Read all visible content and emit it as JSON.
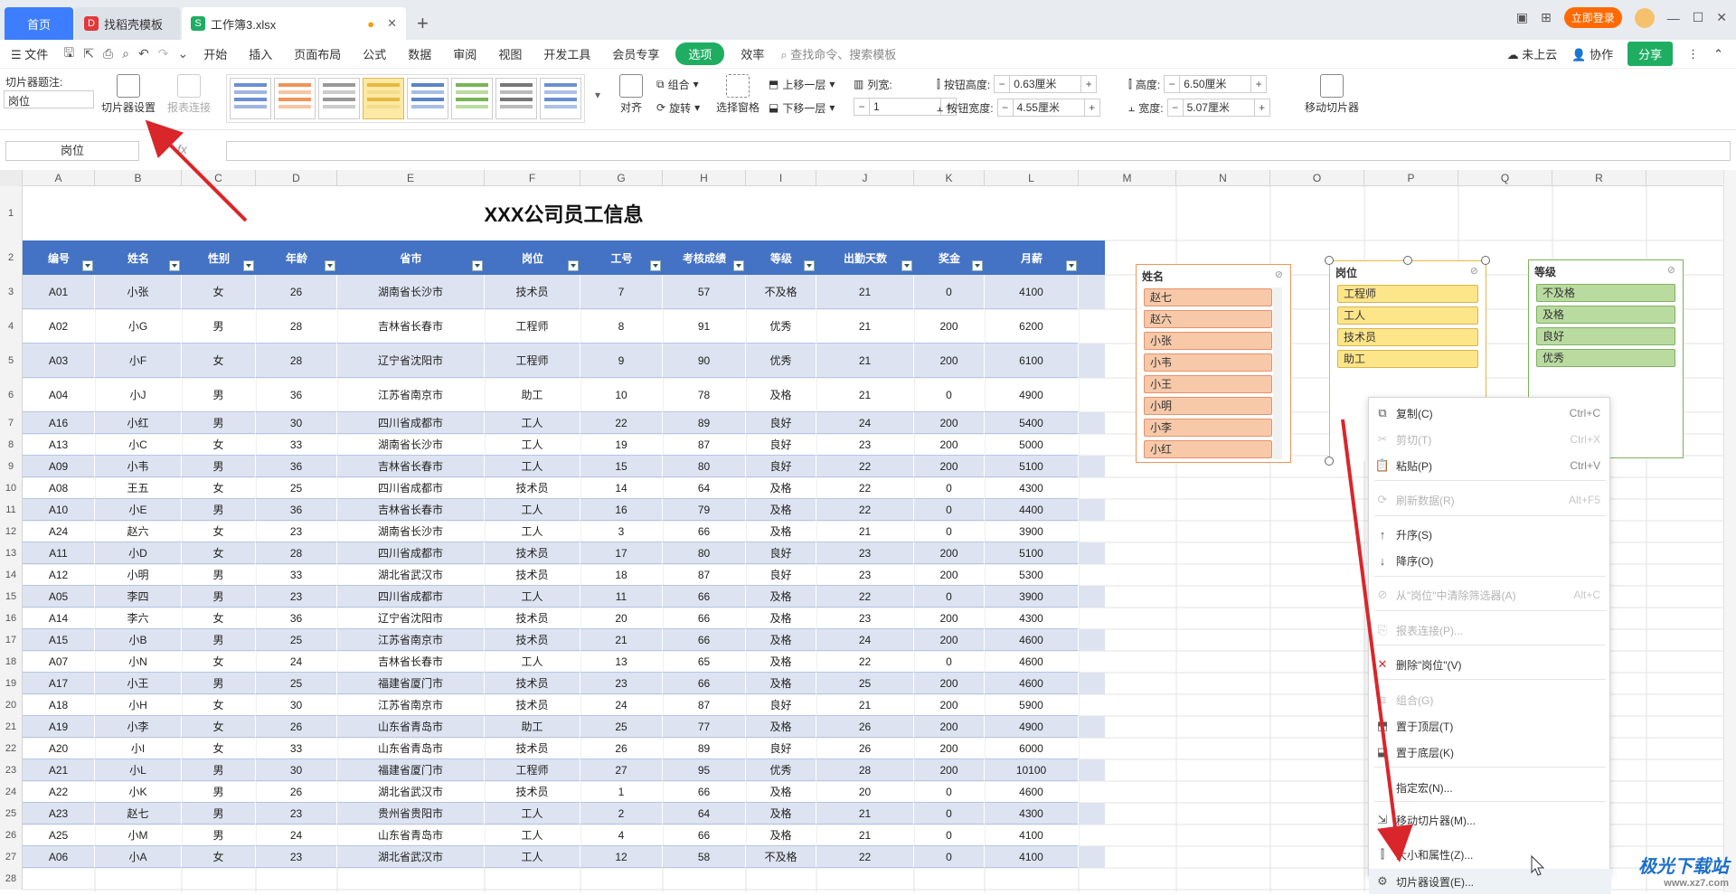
{
  "tabs": {
    "home": "首页",
    "templates": "找稻壳模板",
    "file": "工作簿3.xlsx",
    "plus": "+"
  },
  "window": {
    "login": "立即登录"
  },
  "menu": {
    "file": "文件",
    "items": [
      "开始",
      "插入",
      "页面布局",
      "公式",
      "数据",
      "审阅",
      "视图",
      "开发工具",
      "会员专享"
    ],
    "active": "选项",
    "efficiency": "效率",
    "search": "查找命令、搜索模板",
    "not_cloud": "未上云",
    "collab": "协作",
    "share": "分享"
  },
  "ribbon": {
    "caption_label": "切片器题注:",
    "caption_value": "岗位",
    "slicer_settings": "切片器设置",
    "report_link": "报表连接",
    "align": "对齐",
    "group": "组合",
    "rotate": "旋转",
    "selection_pane": "选择窗格",
    "bring_forward": "上移一层",
    "send_backward": "下移一层",
    "columns_label": "列宽:",
    "columns_value": "1",
    "btn_height_label": "按钮高度:",
    "btn_height": "0.63厘米",
    "btn_width_label": "按钮宽度:",
    "btn_width": "4.55厘米",
    "height_label": "高度:",
    "height": "6.50厘米",
    "width_label": "宽度:",
    "width": "5.07厘米",
    "move_slicer": "移动切片器"
  },
  "formula": {
    "name_box": "岗位",
    "fx": "fx"
  },
  "columns": [
    "A",
    "B",
    "C",
    "D",
    "E",
    "F",
    "G",
    "H",
    "I",
    "J",
    "K",
    "L",
    "M",
    "N",
    "O",
    "P",
    "Q",
    "R"
  ],
  "rows": [
    "1",
    "2",
    "3",
    "4",
    "5",
    "6",
    "7",
    "8",
    "9",
    "10",
    "11",
    "12",
    "13",
    "14",
    "15",
    "16",
    "17",
    "18",
    "19",
    "20",
    "21",
    "22",
    "23",
    "24",
    "25",
    "26",
    "27",
    "28"
  ],
  "sheet_title": "XXX公司员工信息",
  "headers": [
    "编号",
    "姓名",
    "性别",
    "年龄",
    "省市",
    "岗位",
    "工号",
    "考核成绩",
    "等级",
    "出勤天数",
    "奖金",
    "月薪"
  ],
  "table": [
    [
      "A01",
      "小张",
      "女",
      "26",
      "湖南省长沙市",
      "技术员",
      "7",
      "57",
      "不及格",
      "21",
      "0",
      "4100"
    ],
    [
      "A02",
      "小G",
      "男",
      "28",
      "吉林省长春市",
      "工程师",
      "8",
      "91",
      "优秀",
      "21",
      "200",
      "6200"
    ],
    [
      "A03",
      "小F",
      "女",
      "28",
      "辽宁省沈阳市",
      "工程师",
      "9",
      "90",
      "优秀",
      "21",
      "200",
      "6100"
    ],
    [
      "A04",
      "小J",
      "男",
      "36",
      "江苏省南京市",
      "助工",
      "10",
      "78",
      "及格",
      "21",
      "0",
      "4900"
    ],
    [
      "A16",
      "小红",
      "男",
      "30",
      "四川省成都市",
      "工人",
      "22",
      "89",
      "良好",
      "24",
      "200",
      "5400"
    ],
    [
      "A13",
      "小C",
      "女",
      "33",
      "湖南省长沙市",
      "工人",
      "19",
      "87",
      "良好",
      "23",
      "200",
      "5000"
    ],
    [
      "A09",
      "小韦",
      "男",
      "36",
      "吉林省长春市",
      "工人",
      "15",
      "80",
      "良好",
      "22",
      "200",
      "5100"
    ],
    [
      "A08",
      "王五",
      "女",
      "25",
      "四川省成都市",
      "技术员",
      "14",
      "64",
      "及格",
      "22",
      "0",
      "4300"
    ],
    [
      "A10",
      "小E",
      "男",
      "36",
      "吉林省长春市",
      "工人",
      "16",
      "79",
      "及格",
      "22",
      "0",
      "4400"
    ],
    [
      "A24",
      "赵六",
      "女",
      "23",
      "湖南省长沙市",
      "工人",
      "3",
      "66",
      "及格",
      "21",
      "0",
      "3900"
    ],
    [
      "A11",
      "小D",
      "女",
      "28",
      "四川省成都市",
      "技术员",
      "17",
      "80",
      "良好",
      "23",
      "200",
      "5100"
    ],
    [
      "A12",
      "小明",
      "男",
      "33",
      "湖北省武汉市",
      "技术员",
      "18",
      "87",
      "良好",
      "23",
      "200",
      "5300"
    ],
    [
      "A05",
      "李四",
      "男",
      "23",
      "四川省成都市",
      "工人",
      "11",
      "66",
      "及格",
      "22",
      "0",
      "3900"
    ],
    [
      "A14",
      "李六",
      "女",
      "36",
      "辽宁省沈阳市",
      "技术员",
      "20",
      "66",
      "及格",
      "23",
      "200",
      "4300"
    ],
    [
      "A15",
      "小B",
      "男",
      "25",
      "江苏省南京市",
      "技术员",
      "21",
      "66",
      "及格",
      "24",
      "200",
      "4600"
    ],
    [
      "A07",
      "小N",
      "女",
      "24",
      "吉林省长春市",
      "工人",
      "13",
      "65",
      "及格",
      "22",
      "0",
      "4600"
    ],
    [
      "A17",
      "小王",
      "男",
      "25",
      "福建省厦门市",
      "技术员",
      "23",
      "66",
      "及格",
      "25",
      "200",
      "4600"
    ],
    [
      "A18",
      "小H",
      "女",
      "30",
      "江苏省南京市",
      "技术员",
      "24",
      "87",
      "良好",
      "21",
      "200",
      "5900"
    ],
    [
      "A19",
      "小李",
      "女",
      "26",
      "山东省青岛市",
      "助工",
      "25",
      "77",
      "及格",
      "26",
      "200",
      "4900"
    ],
    [
      "A20",
      "小I",
      "女",
      "33",
      "山东省青岛市",
      "技术员",
      "26",
      "89",
      "良好",
      "26",
      "200",
      "6000"
    ],
    [
      "A21",
      "小L",
      "男",
      "30",
      "福建省厦门市",
      "工程师",
      "27",
      "95",
      "优秀",
      "28",
      "200",
      "10100"
    ],
    [
      "A22",
      "小K",
      "男",
      "26",
      "湖北省武汉市",
      "技术员",
      "1",
      "66",
      "及格",
      "20",
      "0",
      "4600"
    ],
    [
      "A23",
      "赵七",
      "男",
      "23",
      "贵州省贵阳市",
      "工人",
      "2",
      "64",
      "及格",
      "21",
      "0",
      "4300"
    ],
    [
      "A25",
      "小M",
      "男",
      "24",
      "山东省青岛市",
      "工人",
      "4",
      "66",
      "及格",
      "21",
      "0",
      "4100"
    ],
    [
      "A06",
      "小A",
      "女",
      "23",
      "湖北省武汉市",
      "工人",
      "12",
      "58",
      "不及格",
      "22",
      "0",
      "4100"
    ]
  ],
  "slicers": {
    "name": {
      "title": "姓名",
      "items": [
        "赵七",
        "赵六",
        "小张",
        "小韦",
        "小王",
        "小明",
        "小李",
        "小红"
      ]
    },
    "post": {
      "title": "岗位",
      "items": [
        "工程师",
        "工人",
        "技术员",
        "助工"
      ]
    },
    "grade": {
      "title": "等级",
      "items": [
        "不及格",
        "及格",
        "良好",
        "优秀"
      ]
    }
  },
  "context_menu": [
    {
      "label": "复制(C)",
      "key": "Ctrl+C",
      "icon": "copy-icon",
      "disabled": false
    },
    {
      "label": "剪切(T)",
      "key": "Ctrl+X",
      "icon": "cut-icon",
      "disabled": true
    },
    {
      "label": "粘贴(P)",
      "key": "Ctrl+V",
      "icon": "paste-icon",
      "disabled": false
    },
    {
      "label": "刷新数据(R)",
      "key": "Alt+F5",
      "icon": "refresh-icon",
      "disabled": true
    },
    {
      "label": "升序(S)",
      "key": "",
      "icon": "sort-asc-icon",
      "disabled": false
    },
    {
      "label": "降序(O)",
      "key": "",
      "icon": "sort-desc-icon",
      "disabled": false
    },
    {
      "label": "从\"岗位\"中清除筛选器(A)",
      "key": "Alt+C",
      "icon": "clear-filter-icon",
      "disabled": true
    },
    {
      "label": "报表连接(P)...",
      "key": "",
      "icon": "report-link-icon",
      "disabled": true
    },
    {
      "label": "删除\"岗位\"(V)",
      "key": "",
      "icon": "delete-icon",
      "disabled": false
    },
    {
      "label": "组合(G)",
      "key": "",
      "icon": "group-icon",
      "disabled": true
    },
    {
      "label": "置于顶层(T)",
      "key": "",
      "icon": "bring-front-icon",
      "disabled": false
    },
    {
      "label": "置于底层(K)",
      "key": "",
      "icon": "send-back-icon",
      "disabled": false
    },
    {
      "label": "指定宏(N)...",
      "key": "",
      "icon": "",
      "disabled": false
    },
    {
      "label": "移动切片器(M)...",
      "key": "",
      "icon": "move-icon",
      "disabled": false
    },
    {
      "label": "大小和属性(Z)...",
      "key": "",
      "icon": "size-icon",
      "disabled": false
    },
    {
      "label": "切片器设置(E)...",
      "key": "",
      "icon": "slicer-settings-icon",
      "disabled": false
    }
  ],
  "watermark": {
    "brand": "极光下载站",
    "url": "www.xz7.com"
  },
  "colors": {
    "header_blue": "#4472c4",
    "band": "#dde3f0",
    "name_slicer": "#f7c9a9",
    "post_slicer": "#fde58a",
    "grade_slicer": "#b9dba0",
    "accent_green": "#1fad62",
    "arrow_red": "#d9262b"
  }
}
